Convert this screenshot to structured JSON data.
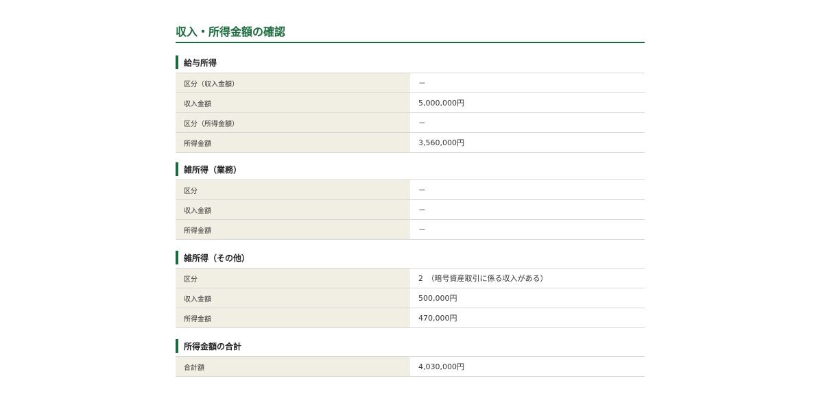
{
  "page": {
    "title": "収入・所得金額の確認"
  },
  "sections": [
    {
      "heading": "給与所得",
      "rows": [
        {
          "label": "区分（収入金額）",
          "value": "－"
        },
        {
          "label": "収入金額",
          "value": "5,000,000円"
        },
        {
          "label": "区分（所得金額）",
          "value": "－"
        },
        {
          "label": "所得金額",
          "value": "3,560,000円"
        }
      ]
    },
    {
      "heading": "雑所得（業務）",
      "rows": [
        {
          "label": "区分",
          "value": "－"
        },
        {
          "label": "収入金額",
          "value": "－"
        },
        {
          "label": "所得金額",
          "value": "－"
        }
      ]
    },
    {
      "heading": "雑所得（その他）",
      "rows": [
        {
          "label": "区分",
          "value": "2　（暗号資産取引に係る収入がある）"
        },
        {
          "label": "収入金額",
          "value": "500,000円"
        },
        {
          "label": "所得金額",
          "value": "470,000円"
        }
      ]
    },
    {
      "heading": "所得金額の合計",
      "rows": [
        {
          "label": "合計額",
          "value": "4,030,000円"
        }
      ]
    }
  ],
  "colors": {
    "accent": "#1a6b3c",
    "label_background": "#f1efe4",
    "border": "#d6d6d6"
  }
}
